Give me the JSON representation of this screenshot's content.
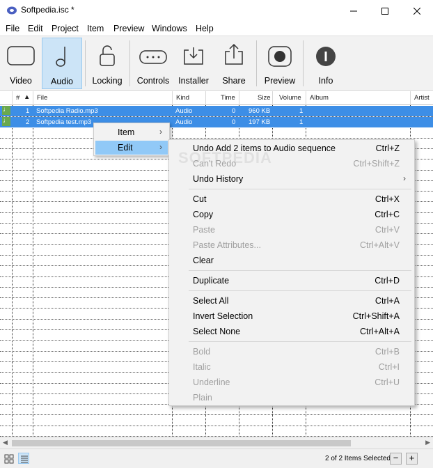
{
  "window": {
    "title": "Softpedia.isc *"
  },
  "menubar": [
    "File",
    "Edit",
    "Project",
    "Item",
    "Preview",
    "Windows",
    "Help"
  ],
  "toolbar": {
    "buttons": [
      {
        "label": "Video",
        "icon": "video-icon"
      },
      {
        "label": "Audio",
        "icon": "music-note-icon",
        "active": true
      },
      {
        "label": "Locking",
        "icon": "lock-icon"
      },
      {
        "label": "Controls",
        "icon": "controls-icon"
      },
      {
        "label": "Installer",
        "icon": "installer-icon"
      },
      {
        "label": "Share",
        "icon": "share-icon"
      },
      {
        "label": "Preview",
        "icon": "preview-icon"
      },
      {
        "label": "Info",
        "icon": "info-icon"
      }
    ]
  },
  "table": {
    "columns": [
      "#",
      "File",
      "Kind",
      "Time",
      "Size",
      "Volume",
      "Album",
      "Artist"
    ],
    "rows": [
      {
        "num": "1",
        "file": "Softpedia Radio.mp3",
        "kind": "Audio",
        "time": "0",
        "size": "960 KB",
        "volume": "1"
      },
      {
        "num": "2",
        "file": "Softpedia test.mp3",
        "kind": "Audio",
        "time": "0",
        "size": "197 KB",
        "volume": "1"
      }
    ]
  },
  "submenu": {
    "items": [
      {
        "label": "Item"
      },
      {
        "label": "Edit"
      }
    ]
  },
  "context_menu": {
    "items": [
      {
        "label": "Undo Add 2 items to Audio sequence",
        "shortcut": "Ctrl+Z",
        "enabled": true
      },
      {
        "label": "Can't Redo",
        "shortcut": "Ctrl+Shift+Z",
        "enabled": false
      },
      {
        "label": "Undo History",
        "shortcut": "",
        "enabled": true
      },
      {
        "label": "Cut",
        "shortcut": "Ctrl+X",
        "enabled": true
      },
      {
        "label": "Copy",
        "shortcut": "Ctrl+C",
        "enabled": true
      },
      {
        "label": "Paste",
        "shortcut": "Ctrl+V",
        "enabled": false
      },
      {
        "label": "Paste Attributes...",
        "shortcut": "Ctrl+Alt+V",
        "enabled": false
      },
      {
        "label": "Clear",
        "shortcut": "",
        "enabled": true
      },
      {
        "label": "Duplicate",
        "shortcut": "Ctrl+D",
        "enabled": true
      },
      {
        "label": "Select All",
        "shortcut": "Ctrl+A",
        "enabled": true
      },
      {
        "label": "Invert Selection",
        "shortcut": "Ctrl+Shift+A",
        "enabled": true
      },
      {
        "label": "Select None",
        "shortcut": "Ctrl+Alt+A",
        "enabled": true
      },
      {
        "label": "Bold",
        "shortcut": "Ctrl+B",
        "enabled": false
      },
      {
        "label": "Italic",
        "shortcut": "Ctrl+I",
        "enabled": false
      },
      {
        "label": "Underline",
        "shortcut": "Ctrl+U",
        "enabled": false
      },
      {
        "label": "Plain",
        "shortcut": "",
        "enabled": false
      }
    ]
  },
  "status": {
    "text": "2 of 2 Items Selected",
    "minus": "−",
    "plus": "+"
  },
  "watermark": "SOFTPEDIA",
  "colors": {
    "selection": "#3d8ee6",
    "accent": "#cce4f7",
    "note": "#6aa84f"
  }
}
